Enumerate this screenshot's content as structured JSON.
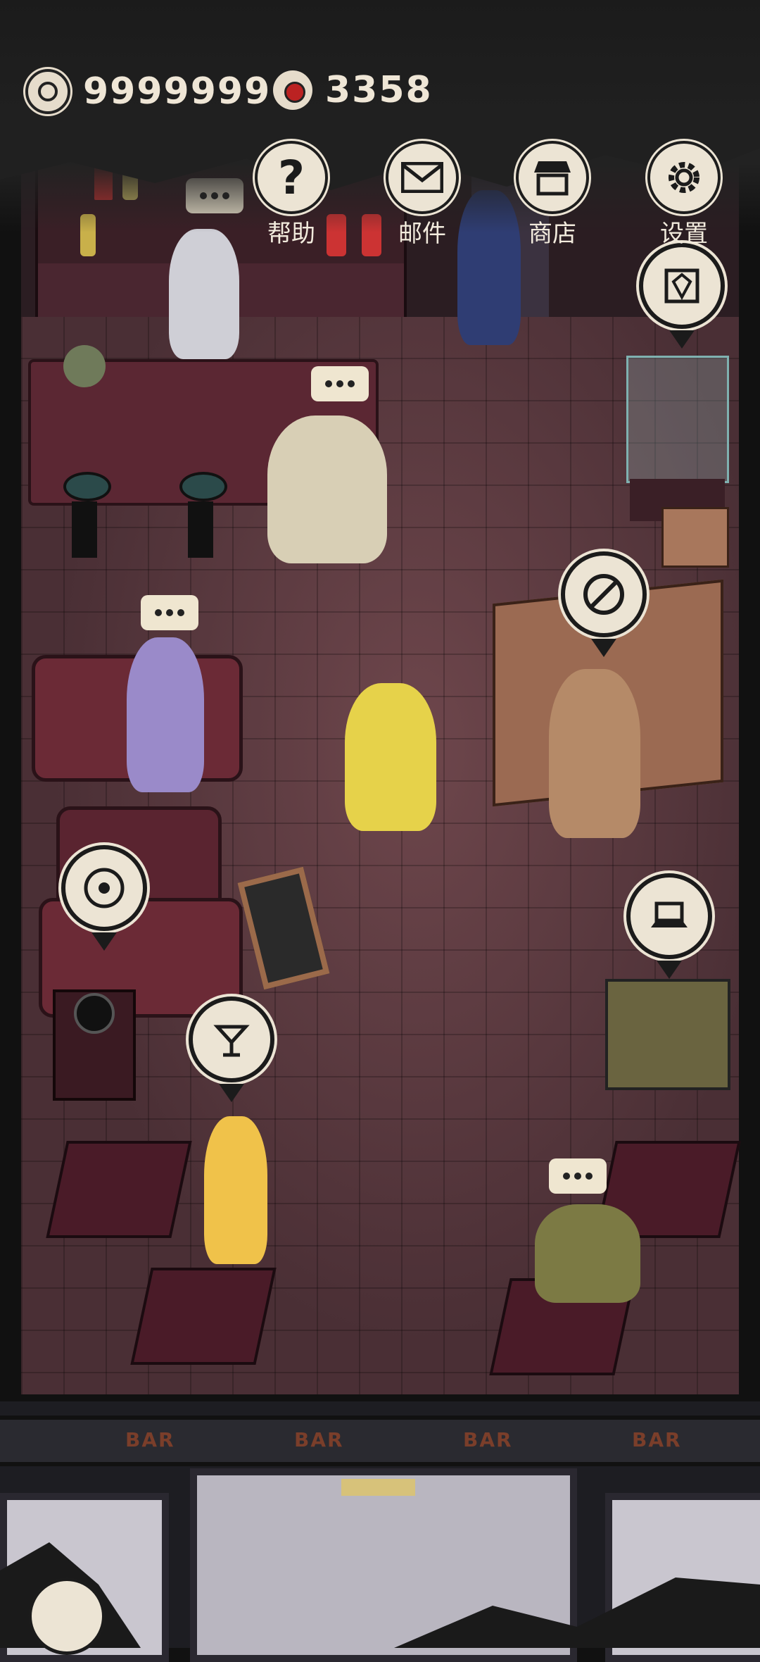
{
  "currencies": [
    {
      "icon": "coin-icon",
      "value": "9999999"
    },
    {
      "icon": "red-eye-gem-icon",
      "value": "3358"
    }
  ],
  "menu": [
    {
      "id": "help",
      "icon": "question-mark-icon",
      "label": "帮助"
    },
    {
      "id": "mail",
      "icon": "envelope-icon",
      "label": "邮件"
    },
    {
      "id": "shop",
      "icon": "shop-awning-icon",
      "label": "商店"
    },
    {
      "id": "settings",
      "icon": "gear-icon",
      "label": "设置"
    }
  ],
  "storefront": {
    "signs": [
      "BAR",
      "BAR",
      "BAR",
      "BAR"
    ]
  },
  "colors": {
    "ui_cream": "#ece4d4",
    "ink_dark": "#1b1b1b",
    "floor": "#4a2f35",
    "furniture": "#5b2733"
  },
  "poi_icons": [
    "diamond-frame-icon",
    "no-gear-icon",
    "vinyl-record-icon",
    "laptop-icon",
    "cocktail-glass-icon"
  ]
}
